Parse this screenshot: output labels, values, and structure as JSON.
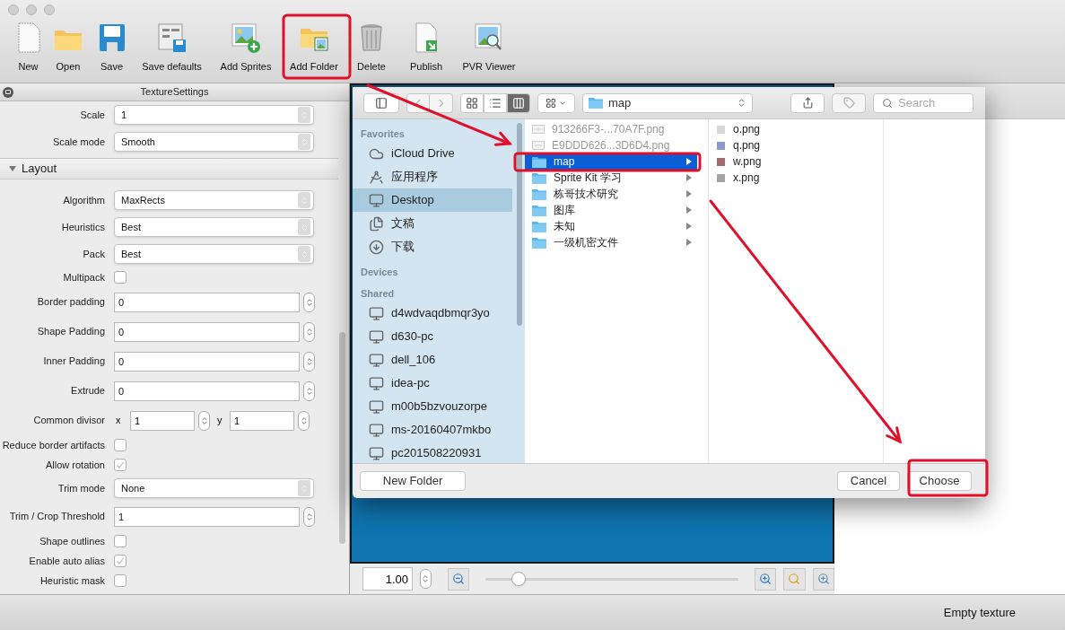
{
  "toolbar": [
    {
      "label": "New",
      "kind": "new"
    },
    {
      "label": "Open",
      "kind": "open"
    },
    {
      "label": "Save",
      "kind": "save"
    },
    {
      "label": "Save defaults",
      "kind": "save-defaults"
    },
    {
      "label": "Add Sprites",
      "kind": "add-sprites"
    },
    {
      "label": "Add Folder",
      "kind": "add-folder"
    },
    {
      "label": "Delete",
      "kind": "delete"
    },
    {
      "label": "Publish",
      "kind": "publish"
    },
    {
      "label": "PVR Viewer",
      "kind": "viewer"
    }
  ],
  "settings_panel": {
    "title": "TextureSettings",
    "rows": [
      {
        "kind": "select",
        "label": "Scale",
        "value": "1"
      },
      {
        "kind": "select",
        "label": "Scale mode",
        "value": "Smooth"
      },
      {
        "kind": "section",
        "label": "Layout",
        "expanded": true
      },
      {
        "kind": "select",
        "label": "Algorithm",
        "value": "MaxRects"
      },
      {
        "kind": "select",
        "label": "Heuristics",
        "value": "Best"
      },
      {
        "kind": "select",
        "label": "Pack",
        "value": "Best"
      },
      {
        "kind": "checkbox",
        "label": "Multipack",
        "checked": false
      },
      {
        "kind": "spin",
        "label": "Border padding",
        "value": "0"
      },
      {
        "kind": "spin",
        "label": "Shape Padding",
        "value": "0"
      },
      {
        "kind": "spin",
        "label": "Inner Padding",
        "value": "0"
      },
      {
        "kind": "spin",
        "label": "Extrude",
        "value": "0"
      },
      {
        "kind": "divisor",
        "label": "Common divisor",
        "x_label": "x",
        "x_value": "1",
        "y_label": "y",
        "y_value": "1"
      },
      {
        "kind": "checkbox",
        "label": "Reduce border artifacts",
        "checked": false
      },
      {
        "kind": "checkbox",
        "label": "Allow rotation",
        "checked": true
      },
      {
        "kind": "select",
        "label": "Trim mode",
        "value": "None"
      },
      {
        "kind": "spin",
        "label": "Trim / Crop Threshold",
        "value": "1"
      },
      {
        "kind": "checkbox",
        "label": "Shape outlines",
        "checked": false
      },
      {
        "kind": "checkbox",
        "label": "Enable auto alias",
        "checked": true
      },
      {
        "kind": "checkbox",
        "label": "Heuristic mask",
        "checked": false
      }
    ]
  },
  "canvas": {
    "zoom_value": "1.00",
    "zoom_slider": {
      "level": 0.13
    }
  },
  "status_bar": {
    "text": "Empty texture"
  },
  "dialog": {
    "view_modes": [
      {
        "kind": "icons",
        "selected": false
      },
      {
        "kind": "list",
        "selected": false
      },
      {
        "kind": "columns",
        "selected": true
      }
    ],
    "path": "map",
    "search": {
      "placeholder": "Search"
    },
    "sidebar": [
      {
        "heading": "Favorites",
        "items": [
          {
            "label": "iCloud Drive",
            "kind": "cloud",
            "selected": false
          },
          {
            "label": "应用程序",
            "kind": "apps",
            "selected": false
          },
          {
            "label": "Desktop",
            "kind": "desktop",
            "selected": true
          },
          {
            "label": "文稿",
            "kind": "documents",
            "selected": false
          },
          {
            "label": "下载",
            "kind": "downloads",
            "selected": false
          }
        ]
      },
      {
        "heading": "Devices"
      },
      {
        "heading": "Shared",
        "items": [
          {
            "label": "d4wdvaqdbmqr3yo",
            "kind": "computer",
            "selected": false
          },
          {
            "label": "d630-pc",
            "kind": "computer",
            "selected": false
          },
          {
            "label": "dell_106",
            "kind": "computer",
            "selected": false
          },
          {
            "label": "idea-pc",
            "kind": "computer",
            "selected": false
          },
          {
            "label": "m00b5bzvouzorpe",
            "kind": "computer",
            "selected": false
          },
          {
            "label": "ms-20160407mkbo",
            "kind": "computer",
            "selected": false
          },
          {
            "label": "pc201508220931",
            "kind": "computer",
            "selected": false
          }
        ]
      }
    ],
    "columns": [
      [
        {
          "name": "913266F3-...70A7F.png",
          "kind": "file",
          "selected": false
        },
        {
          "name": "E9DDD626...3D6D4.png",
          "kind": "file",
          "selected": false
        },
        {
          "name": "map",
          "kind": "folder",
          "selected": true
        },
        {
          "name": "Sprite Kit 学习",
          "kind": "folder",
          "selected": false
        },
        {
          "name": "栋哥技术研究",
          "kind": "folder",
          "selected": false
        },
        {
          "name": "图库",
          "kind": "folder",
          "selected": false
        },
        {
          "name": "未知",
          "kind": "folder",
          "selected": false
        },
        {
          "name": "一级机密文件",
          "kind": "folder",
          "selected": false
        }
      ],
      [
        {
          "name": "o.png",
          "kind": "image",
          "color": "#d8d8d8",
          "selected": false
        },
        {
          "name": "q.png",
          "kind": "image",
          "color": "#8b9bd0",
          "selected": false
        },
        {
          "name": "w.png",
          "kind": "image",
          "color": "#a06a6a",
          "selected": false
        },
        {
          "name": "x.png",
          "kind": "image",
          "color": "#a8a49e",
          "selected": false
        }
      ]
    ],
    "buttons": {
      "new_folder": "New Folder",
      "cancel": "Cancel",
      "choose": "Choose"
    }
  }
}
